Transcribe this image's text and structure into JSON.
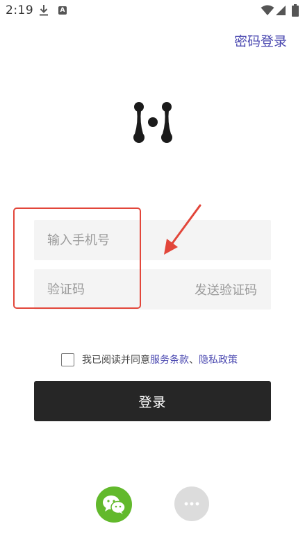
{
  "status_bar": {
    "time": "2:19",
    "icons": [
      "download-icon",
      "a-badge-icon",
      "wifi-icon",
      "signal-icon",
      "battery-icon"
    ],
    "a_badge": "A"
  },
  "header": {
    "password_login_label": "密码登录"
  },
  "logo": {
    "icon": "app-logo-icon"
  },
  "form": {
    "phone_placeholder": "输入手机号",
    "code_placeholder": "验证码",
    "send_code_label": "发送验证码"
  },
  "agreement": {
    "prefix": "我已阅读并同意",
    "terms_label": "服务条款",
    "separator": "、",
    "privacy_label": "隐私政策"
  },
  "login_button_label": "登录",
  "third_party": {
    "wechat_icon": "wechat-icon",
    "more_icon": "more-icon"
  },
  "colors": {
    "accent": "#4a48b0",
    "button_bg": "#262626",
    "wechat_green": "#62b92c",
    "annotation_red": "#e2463a",
    "field_bg": "#f4f4f4"
  }
}
